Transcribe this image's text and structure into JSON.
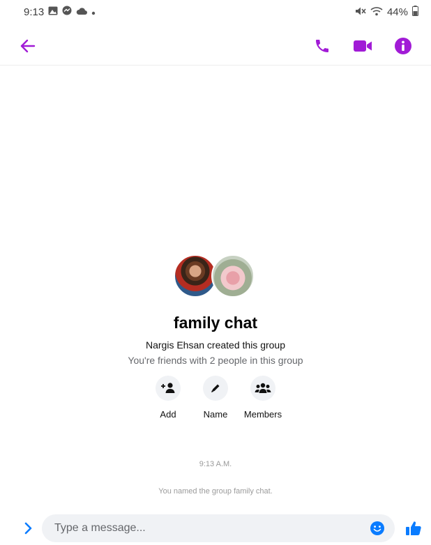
{
  "status_bar": {
    "time": "9:13",
    "left_icons": [
      "image-icon",
      "messenger-icon",
      "cloud-icon",
      "dot-icon"
    ],
    "battery": "44%",
    "right_icons": [
      "mute-icon",
      "wifi-icon",
      "battery-icon"
    ]
  },
  "app_bar": {
    "back_icon": "arrow-left-icon",
    "actions": [
      "phone-icon",
      "video-icon",
      "info-icon"
    ],
    "accent": "#a11bd6"
  },
  "group": {
    "name": "family chat",
    "created_by": "Nargis Ehsan created this group",
    "friends_note": "You're friends with 2 people in this group",
    "actions": [
      {
        "label": "Add",
        "icon": "add-person-icon"
      },
      {
        "label": "Name",
        "icon": "pencil-icon"
      },
      {
        "label": "Members",
        "icon": "members-icon"
      }
    ]
  },
  "timeline": {
    "timestamp": "9:13 A.M.",
    "system_message": "You named the group family chat."
  },
  "composer": {
    "placeholder": "Type a message...",
    "accent": "#0a7cff"
  }
}
